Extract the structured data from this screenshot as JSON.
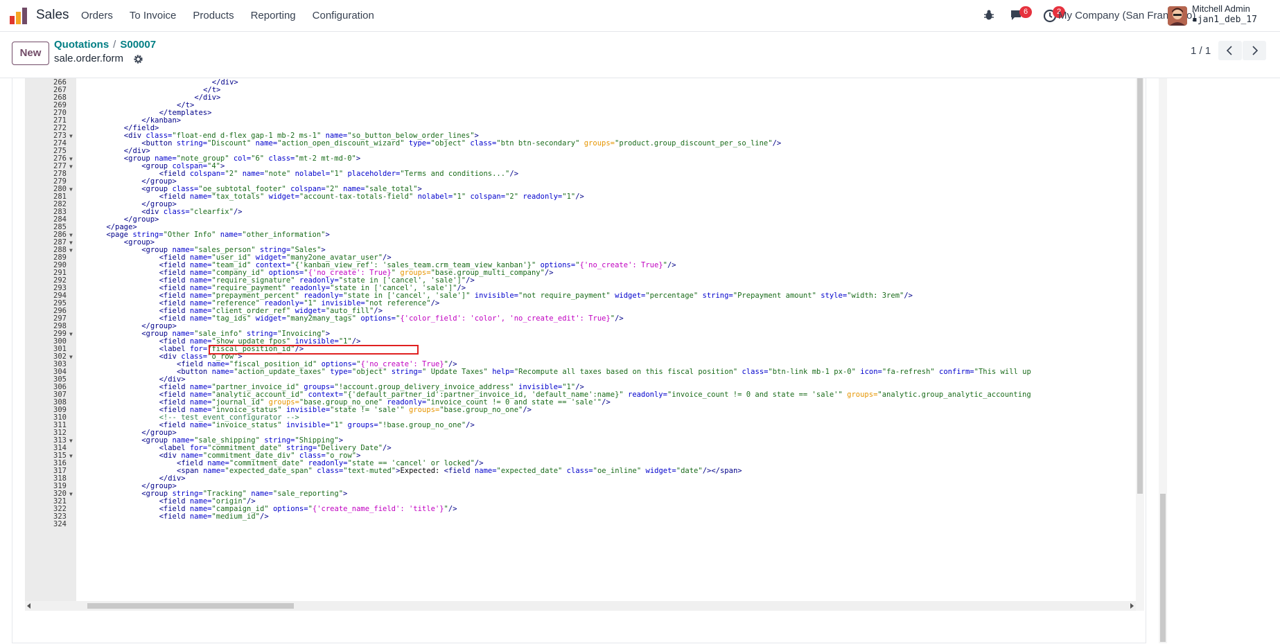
{
  "navbar": {
    "app_name": "Sales",
    "menu": [
      "Orders",
      "To Invoice",
      "Products",
      "Reporting",
      "Configuration"
    ],
    "messages_count": "6",
    "activities_count": "2",
    "company": "My Company (San Francisco)",
    "user_name": "Mitchell Admin",
    "database": "jan1_deb_17"
  },
  "control": {
    "new_label": "New",
    "breadcrumb_parent": "Quotations",
    "breadcrumb_sep": "/",
    "breadcrumb_current": "S00007",
    "record_name": "sale.order.form",
    "pager": "1 / 1"
  },
  "code_lines": [
    {
      "n": "266",
      "f": "",
      "i": 28,
      "h": "<span class='t'>&lt;/div&gt;</span>"
    },
    {
      "n": "267",
      "f": "",
      "i": 26,
      "h": "<span class='t'>&lt;/t&gt;</span>"
    },
    {
      "n": "268",
      "f": "",
      "i": 24,
      "h": "<span class='t'>&lt;/div&gt;</span>"
    },
    {
      "n": "269",
      "f": "",
      "i": 20,
      "h": "<span class='t'>&lt;/t&gt;</span>"
    },
    {
      "n": "270",
      "f": "",
      "i": 16,
      "h": "<span class='t'>&lt;/templates&gt;</span>"
    },
    {
      "n": "271",
      "f": "",
      "i": 12,
      "h": "<span class='t'>&lt;/kanban&gt;</span>"
    },
    {
      "n": "272",
      "f": "",
      "i": 8,
      "h": "<span class='t'>&lt;/field&gt;</span>"
    },
    {
      "n": "273",
      "f": "▼",
      "i": 8,
      "h": "<span class='t'>&lt;div </span><span class='a'>class=</span><span class='s'>\"float-end d-flex gap-1 mb-2 ms-1\"</span><span class='a'> name=</span><span class='s'>\"so_button_below_order_lines\"</span><span class='t'>&gt;</span>"
    },
    {
      "n": "274",
      "f": "",
      "i": 12,
      "h": "<span class='t'>&lt;button </span><span class='a'>string=</span><span class='s'>\"Discount\"</span><span class='a'> name=</span><span class='s'>\"action_open_discount_wizard\"</span><span class='a'> type=</span><span class='s'>\"object\"</span><span class='a'> class=</span><span class='s'>\"btn btn-secondary\"</span> <span class='o'>groups=</span><span class='s'>\"product.group_discount_per_so_line\"</span><span class='t'>/&gt;</span>"
    },
    {
      "n": "275",
      "f": "",
      "i": 8,
      "h": "<span class='t'>&lt;/div&gt;</span>"
    },
    {
      "n": "276",
      "f": "▼",
      "i": 8,
      "h": "<span class='t'>&lt;group </span><span class='a'>name=</span><span class='s'>\"note_group\"</span><span class='a'> col=</span><span class='s'>\"6\"</span><span class='a'> class=</span><span class='s'>\"mt-2 mt-md-0\"</span><span class='t'>&gt;</span>"
    },
    {
      "n": "277",
      "f": "▼",
      "i": 12,
      "h": "<span class='t'>&lt;group </span><span class='a'>colspan=</span><span class='s'>\"4\"</span><span class='t'>&gt;</span>"
    },
    {
      "n": "278",
      "f": "",
      "i": 16,
      "h": "<span class='t'>&lt;field </span><span class='a'>colspan=</span><span class='s'>\"2\"</span><span class='a'> name=</span><span class='s'>\"note\"</span><span class='a'> nolabel=</span><span class='s'>\"1\"</span><span class='a'> placeholder=</span><span class='s'>\"Terms and conditions...\"</span><span class='t'>/&gt;</span>"
    },
    {
      "n": "279",
      "f": "",
      "i": 12,
      "h": "<span class='t'>&lt;/group&gt;</span>"
    },
    {
      "n": "280",
      "f": "▼",
      "i": 12,
      "h": "<span class='t'>&lt;group </span><span class='a'>class=</span><span class='s'>\"oe_subtotal_footer\"</span><span class='a'> colspan=</span><span class='s'>\"2\"</span><span class='a'> name=</span><span class='s'>\"sale_total\"</span><span class='t'>&gt;</span>"
    },
    {
      "n": "281",
      "f": "",
      "i": 16,
      "h": "<span class='t'>&lt;field </span><span class='a'>name=</span><span class='s'>\"tax_totals\"</span><span class='a'> widget=</span><span class='s'>\"account-tax-totals-field\"</span><span class='a'> nolabel=</span><span class='s'>\"1\"</span><span class='a'> colspan=</span><span class='s'>\"2\"</span><span class='a'> readonly=</span><span class='s'>\"1\"</span><span class='t'>/&gt;</span>"
    },
    {
      "n": "282",
      "f": "",
      "i": 12,
      "h": "<span class='t'>&lt;/group&gt;</span>"
    },
    {
      "n": "283",
      "f": "",
      "i": 12,
      "h": "<span class='t'>&lt;div </span><span class='a'>class=</span><span class='s'>\"clearfix\"</span><span class='t'>/&gt;</span>"
    },
    {
      "n": "284",
      "f": "",
      "i": 8,
      "h": "<span class='t'>&lt;/group&gt;</span>"
    },
    {
      "n": "285",
      "f": "",
      "i": 4,
      "h": "<span class='t'>&lt;/page&gt;</span>"
    },
    {
      "n": "286",
      "f": "▼",
      "i": 4,
      "h": "<span class='t'>&lt;page </span><span class='a'>string=</span><span class='s'>\"Other Info\"</span><span class='a'> name=</span><span class='s'>\"other_information\"</span><span class='t'>&gt;</span>"
    },
    {
      "n": "287",
      "f": "▼",
      "i": 8,
      "h": "<span class='t'>&lt;group&gt;</span>"
    },
    {
      "n": "288",
      "f": "▼",
      "i": 12,
      "h": "<span class='t'>&lt;group </span><span class='a'>name=</span><span class='s'>\"sales_person\"</span><span class='a'> string=</span><span class='s'>\"Sales\"</span><span class='t'>&gt;</span>"
    },
    {
      "n": "289",
      "f": "",
      "i": 16,
      "h": "<span class='t'>&lt;field </span><span class='a'>name=</span><span class='s'>\"user_id\"</span><span class='a'> widget=</span><span class='s'>\"many2one_avatar_user\"</span><span class='t'>/&gt;</span>"
    },
    {
      "n": "290",
      "f": "",
      "i": 16,
      "h": "<span class='t'>&lt;field </span><span class='a'>name=</span><span class='s'>\"team_id\"</span><span class='a'> context=</span><span class='s'>\"{'kanban_view_ref': 'sales_team.crm_team_view_kanban'}\"</span><span class='a'> options=</span><span class='s'>\"</span><span class='m'>{'no_create': True}</span><span class='s'>\"</span><span class='t'>/&gt;</span>"
    },
    {
      "n": "291",
      "f": "",
      "i": 16,
      "h": "<span class='t'>&lt;field </span><span class='a'>name=</span><span class='s'>\"company_id\"</span><span class='a'> options=</span><span class='s'>\"</span><span class='m'>{'no_create': True}</span><span class='s'>\"</span> <span class='o'>groups=</span><span class='s'>\"base.group_multi_company\"</span><span class='t'>/&gt;</span>"
    },
    {
      "n": "292",
      "f": "",
      "i": 16,
      "h": "<span class='t'>&lt;field </span><span class='a'>name=</span><span class='s'>\"require_signature\"</span><span class='a'> readonly=</span><span class='s'>\"state in ['cancel', 'sale']\"</span><span class='t'>/&gt;</span>"
    },
    {
      "n": "293",
      "f": "",
      "i": 16,
      "h": "<span class='t'>&lt;field </span><span class='a'>name=</span><span class='s'>\"require_payment\"</span><span class='a'> readonly=</span><span class='s'>\"state in ['cancel', 'sale']\"</span><span class='t'>/&gt;</span>"
    },
    {
      "n": "294",
      "f": "",
      "i": 16,
      "h": "<span class='t'>&lt;field </span><span class='a'>name=</span><span class='s'>\"prepayment_percent\"</span><span class='a'> readonly=</span><span class='s'>\"state in ['cancel', 'sale']\"</span><span class='a'> invisible=</span><span class='s'>\"not require_payment\"</span><span class='a'> widget=</span><span class='s'>\"percentage\"</span><span class='a'> string=</span><span class='s'>\"Prepayment amount\"</span><span class='a'> style=</span><span class='s'>\"width: 3rem\"</span><span class='t'>/&gt;</span>"
    },
    {
      "n": "295",
      "f": "",
      "i": 16,
      "h": "<span class='t'>&lt;field </span><span class='a'>name=</span><span class='s'>\"reference\"</span><span class='a'> readonly=</span><span class='s'>\"1\"</span><span class='a'> invisible=</span><span class='s'>\"not reference\"</span><span class='t'>/&gt;</span>"
    },
    {
      "n": "296",
      "f": "",
      "i": 16,
      "h": "<span class='t'>&lt;field </span><span class='a'>name=</span><span class='s'>\"client_order_ref\"</span><span class='a'> widget=</span><span class='s'>\"auto_fill\"</span><span class='t'>/&gt;</span>"
    },
    {
      "n": "297",
      "f": "",
      "i": 16,
      "h": "<span class='t'>&lt;field </span><span class='a'>name=</span><span class='s'>\"tag_ids\"</span><span class='a'> widget=</span><span class='s'>\"many2many_tags\"</span><span class='a'> options=</span><span class='s'>\"</span><span class='m'>{'color_field': 'color', 'no_create_edit': True}</span><span class='s'>\"</span><span class='t'>/&gt;</span>"
    },
    {
      "n": "298",
      "f": "",
      "i": 12,
      "h": "<span class='t'>&lt;/group&gt;</span>"
    },
    {
      "n": "299",
      "f": "▼",
      "i": 12,
      "h": "<span class='t'>&lt;group </span><span class='a'>name=</span><span class='s'>\"sale_info\"</span><span class='a'> string=</span><span class='s'>\"Invoicing\"</span><span class='t'>&gt;</span>"
    },
    {
      "n": "300",
      "f": "",
      "i": 16,
      "h": "<span class='t'>&lt;field </span><span class='a'>name=</span><span class='s'>\"show_update_fpos\"</span><span class='a'> invisible=</span><span class='s'>\"1\"</span><span class='t'>/&gt;</span>"
    },
    {
      "n": "301",
      "f": "",
      "i": 16,
      "h": "<span class='t'>&lt;label </span><span class='a'>for=</span><span class='s'>\"fiscal_position_id\"</span><span class='t'>/&gt;</span>"
    },
    {
      "n": "302",
      "f": "▼",
      "i": 16,
      "h": "<span class='t'>&lt;div </span><span class='a'>class=</span><span class='s'>\"o_row\"</span><span class='t'>&gt;</span>"
    },
    {
      "n": "303",
      "f": "",
      "i": 20,
      "h": "<span class='t'>&lt;field </span><span class='a'>name=</span><span class='s'>\"fiscal_position_id\"</span><span class='a'> options=</span><span class='s'>\"</span><span class='m'>{'no_create': True}</span><span class='s'>\"</span><span class='t'>/&gt;</span>"
    },
    {
      "n": "304",
      "f": "",
      "i": 20,
      "h": "<span class='t'>&lt;button </span><span class='a'>name=</span><span class='s'>\"action_update_taxes\"</span><span class='a'> type=</span><span class='s'>\"object\"</span><span class='a'> string=</span><span class='s'>\" Update Taxes\"</span><span class='a'> help=</span><span class='s'>\"Recompute all taxes based on this fiscal position\"</span><span class='a'> class=</span><span class='s'>\"btn-link mb-1 px-0\"</span><span class='a'> icon=</span><span class='s'>\"fa-refresh\"</span><span class='a'> confirm=</span><span class='s'>\"This will up</span>"
    },
    {
      "n": "305",
      "f": "",
      "i": 16,
      "h": "<span class='t'>&lt;/div&gt;</span>"
    },
    {
      "n": "306",
      "f": "",
      "i": 16,
      "h": "<span class='t'>&lt;field </span><span class='a'>name=</span><span class='s'>\"partner_invoice_id\"</span><span class='a'> groups=</span><span class='s'>\"!account.group_delivery_invoice_address\"</span><span class='a'> invisible=</span><span class='s'>\"1\"</span><span class='t'>/&gt;</span>"
    },
    {
      "n": "307",
      "f": "",
      "i": 16,
      "h": "<span class='t'>&lt;field </span><span class='a'>name=</span><span class='s'>\"analytic_account_id\"</span><span class='a'> context=</span><span class='s'>\"{'default_partner_id':partner_invoice_id, 'default_name':name}\"</span><span class='a'> readonly=</span><span class='s'>\"invoice_count != 0 and state == 'sale'\"</span> <span class='o'>groups=</span><span class='s'>\"analytic.group_analytic_accounting</span>"
    },
    {
      "n": "308",
      "f": "",
      "i": 16,
      "h": "<span class='t'>&lt;field </span><span class='a'>name=</span><span class='s'>\"journal_id\"</span> <span class='o'>groups=</span><span class='s'>\"base.group_no_one\"</span><span class='a'> readonly=</span><span class='s'>\"invoice_count != 0 and state == 'sale'\"</span><span class='t'>/&gt;</span>"
    },
    {
      "n": "309",
      "f": "",
      "i": 16,
      "h": "<span class='t'>&lt;field </span><span class='a'>name=</span><span class='s'>\"invoice_status\"</span><span class='a'> invisible=</span><span class='s'>\"state != 'sale'\"</span> <span class='o'>groups=</span><span class='s'>\"base.group_no_one\"</span><span class='t'>/&gt;</span>"
    },
    {
      "n": "310",
      "f": "",
      "i": 16,
      "h": "<span class='c'>&lt;!-- test_event_configurator --&gt;</span>"
    },
    {
      "n": "311",
      "f": "",
      "i": 16,
      "h": "<span class='t'>&lt;field </span><span class='a'>name=</span><span class='s'>\"invoice_status\"</span><span class='a'> invisible=</span><span class='s'>\"1\"</span><span class='a'> groups=</span><span class='s'>\"!base.group_no_one\"</span><span class='t'>/&gt;</span>"
    },
    {
      "n": "312",
      "f": "",
      "i": 12,
      "h": "<span class='t'>&lt;/group&gt;</span>"
    },
    {
      "n": "313",
      "f": "▼",
      "i": 12,
      "h": "<span class='t'>&lt;group </span><span class='a'>name=</span><span class='s'>\"sale_shipping\"</span><span class='a'> string=</span><span class='s'>\"Shipping\"</span><span class='t'>&gt;</span>"
    },
    {
      "n": "314",
      "f": "",
      "i": 16,
      "h": "<span class='t'>&lt;label </span><span class='a'>for=</span><span class='s'>\"commitment_date\"</span><span class='a'> string=</span><span class='s'>\"Delivery Date\"</span><span class='t'>/&gt;</span>"
    },
    {
      "n": "315",
      "f": "▼",
      "i": 16,
      "h": "<span class='t'>&lt;div </span><span class='a'>name=</span><span class='s'>\"commitment_date_div\"</span><span class='a'> class=</span><span class='s'>\"o_row\"</span><span class='t'>&gt;</span>"
    },
    {
      "n": "316",
      "f": "",
      "i": 20,
      "h": "<span class='t'>&lt;field </span><span class='a'>name=</span><span class='s'>\"commitment_date\"</span><span class='a'> readonly=</span><span class='s'>\"state == 'cancel' or locked\"</span><span class='t'>/&gt;</span>"
    },
    {
      "n": "317",
      "f": "",
      "i": 20,
      "h": "<span class='t'>&lt;span </span><span class='a'>name=</span><span class='s'>\"expected_date_span\"</span><span class='a'> class=</span><span class='s'>\"text-muted\"</span><span class='t'>&gt;</span><span style='color:#000'>Expected: </span><span class='t'>&lt;field </span><span class='a'>name=</span><span class='s'>\"expected_date\"</span><span class='a'> class=</span><span class='s'>\"oe_inline\"</span><span class='a'> widget=</span><span class='s'>\"date\"</span><span class='t'>/&gt;&lt;/span&gt;</span>"
    },
    {
      "n": "318",
      "f": "",
      "i": 16,
      "h": "<span class='t'>&lt;/div&gt;</span>"
    },
    {
      "n": "319",
      "f": "",
      "i": 12,
      "h": "<span class='t'>&lt;/group&gt;</span>"
    },
    {
      "n": "320",
      "f": "▼",
      "i": 12,
      "h": "<span class='t'>&lt;group </span><span class='a'>string=</span><span class='s'>\"Tracking\"</span><span class='a'> name=</span><span class='s'>\"sale_reporting\"</span><span class='t'>&gt;</span>"
    },
    {
      "n": "321",
      "f": "",
      "i": 16,
      "h": "<span class='t'>&lt;field </span><span class='a'>name=</span><span class='s'>\"origin\"</span><span class='t'>/&gt;</span>"
    },
    {
      "n": "322",
      "f": "",
      "i": 16,
      "h": "<span class='t'>&lt;field </span><span class='a'>name=</span><span class='s'>\"campaign_id\"</span><span class='a'> options=</span><span class='s'>\"</span><span class='m'>{'create_name_field': 'title'}</span><span class='s'>\"</span><span class='t'>/&gt;</span>"
    },
    {
      "n": "323",
      "f": "",
      "i": 16,
      "h": "<span class='t'>&lt;field </span><span class='a'>name=</span><span class='s'>\"medium_id\"</span><span class='t'>/&gt;</span>"
    },
    {
      "n": "324",
      "f": "",
      "i": 16,
      "h": ""
    }
  ]
}
